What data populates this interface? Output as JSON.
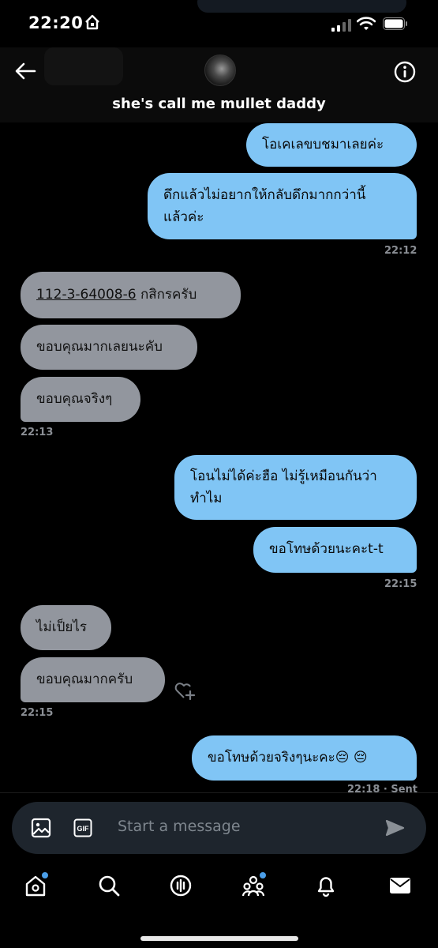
{
  "status": {
    "time": "22:20"
  },
  "header": {
    "title": "she's call me mullet daddy"
  },
  "messages": [
    {
      "text": "โอเคเลขบชมาเลยค่ะ"
    },
    {
      "line1": "ดึกแล้วไม่อยากให้กลับดึกมากกว่านี้",
      "line2": "แล้วค่ะ"
    },
    {
      "number": "112-3-64008-6",
      "rest": " กสิกรครับ"
    },
    {
      "text": "ขอบคุณมากเลยนะคับ"
    },
    {
      "text": "ขอบคุณจริงๆ"
    },
    {
      "line1": "โอนไม่ได้ค่ะฮือ ไม่รู้เหมือนกันว่า",
      "line2": "ทำไม"
    },
    {
      "text": "ขอโทษด้วยนะคะt-t"
    },
    {
      "text": "ไม่เป็ยไร"
    },
    {
      "text": "ขอบคุณมากครับ"
    },
    {
      "text": "ขอโทษด้วยจริงๆนะคะ😔 😔"
    }
  ],
  "timestamps": [
    "22:12",
    "22:13",
    "22:15",
    "22:15",
    "22:18 · Sent"
  ],
  "composer": {
    "placeholder": "Start a message"
  },
  "icons": {
    "back": "arrow-left-icon",
    "info": "info-icon",
    "image": "image-icon",
    "gif": "gif-icon",
    "send": "send-icon",
    "react": "heart-plus-icon",
    "tabs": [
      "home-icon",
      "search-icon",
      "spaces-icon",
      "communities-icon",
      "notifications-icon",
      "messages-icon"
    ]
  },
  "colors": {
    "outgoing_bubble": "#80c5f5",
    "incoming_bubble": "#92969e",
    "accent": "#4a9ee8",
    "background": "#000000"
  }
}
